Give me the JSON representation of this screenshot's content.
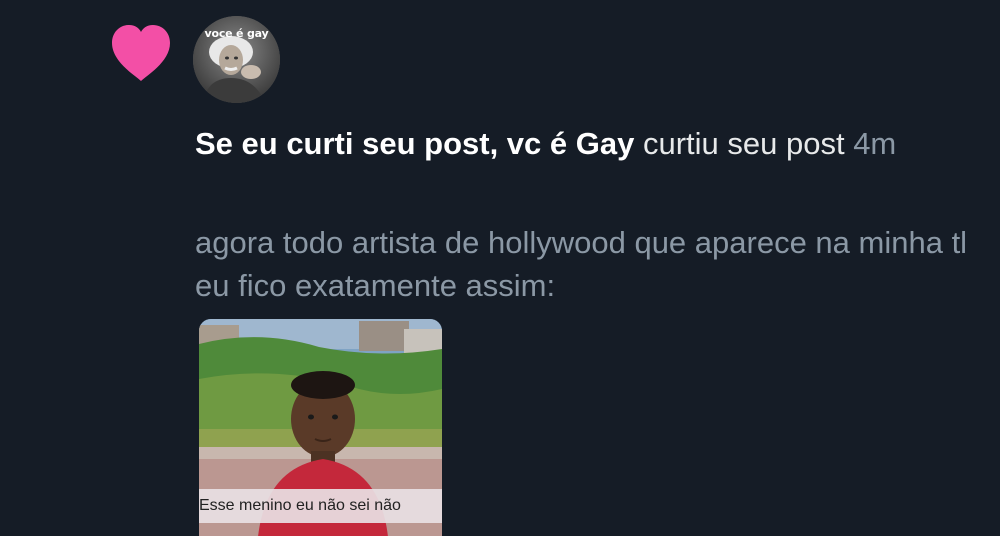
{
  "notification": {
    "icon": "heart-icon",
    "heart_color": "#f34fa6",
    "avatar": {
      "caption": "voce é gay"
    },
    "user_name": "Se eu curti seu post, vc é Gay",
    "action_text": " curtiu seu post",
    "time": "4m",
    "post_text": "agora todo artista de hollywood que aparece na minha tl eu fico exatamente assim:",
    "media": {
      "caption": "Esse menino eu não sei não"
    }
  },
  "colors": {
    "background": "#151c26",
    "primary_text": "#e7e9ea",
    "secondary_text": "#8b98a5"
  }
}
